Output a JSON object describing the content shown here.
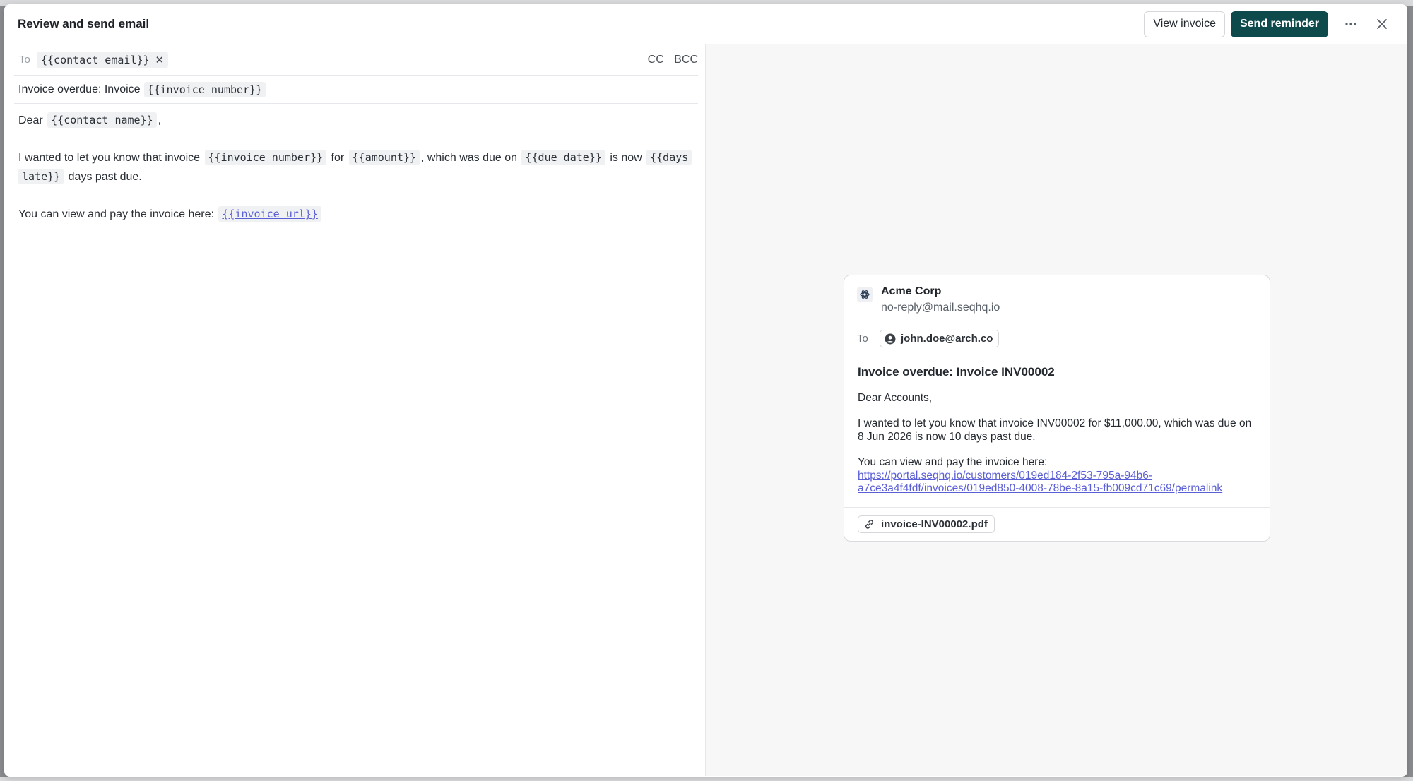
{
  "header": {
    "title": "Review and send email",
    "view_invoice_label": "View invoice",
    "send_reminder_label": "Send reminder"
  },
  "editor": {
    "to_label": "To",
    "to_token": "{{contact email}}",
    "cc_label": "CC",
    "bcc_label": "BCC",
    "subject_prefix": "Invoice overdue: Invoice",
    "subject_token": "{{invoice number}}",
    "greeting": "Dear",
    "greeting_token": "{{contact name}}",
    "greeting_suffix": ",",
    "para1_a": "I wanted to let you know that invoice",
    "para1_token_invoice": "{{invoice number}}",
    "para1_b": "for",
    "para1_token_amount": "{{amount}}",
    "para1_c": ", which was due on",
    "para1_token_due": "{{due date}}",
    "para1_d": "is now",
    "para1_token_days_1": "{{days",
    "para1_token_days_2": "late}}",
    "para1_e": "days past due.",
    "para2_a": "You can view and pay the invoice here:",
    "para2_token_url": "{{invoice url}}"
  },
  "preview": {
    "sender_name": "Acme Corp",
    "sender_email": "no-reply@mail.seqhq.io",
    "to_label": "To",
    "recipient": "john.doe@arch.co",
    "subject": "Invoice overdue: Invoice INV00002",
    "greeting": "Dear Accounts,",
    "para1": "I wanted to let you know that invoice INV00002 for $11,000.00, which was due on 8 Jun 2026 is now 10 days past due.",
    "para2": "You can view and pay the invoice here:",
    "link_line1": "https://portal.seqhq.io/customers/019ed184-2f53-795a-94b6-",
    "link_line2": "a7ce3a4f4fdf/invoices/019ed850-4008-78be-8a15-fb009cd71c69/permalink",
    "attachment": "invoice-INV00002.pdf"
  },
  "colors": {
    "primary": "#0e4a4c",
    "link": "#5b5fd6",
    "preview_bg": "#f7f7f8"
  },
  "icons": [
    "more-icon",
    "close-icon",
    "chip-remove-icon",
    "company-logo-icon",
    "user-circle-icon",
    "link-icon"
  ]
}
